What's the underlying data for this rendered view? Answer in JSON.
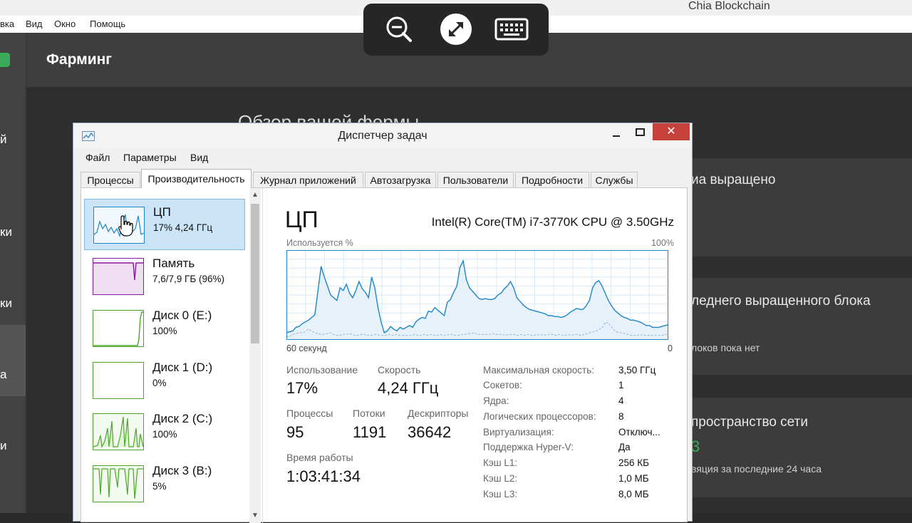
{
  "chia": {
    "window_title": "Chia Blockchain",
    "menu": [
      "вка",
      "Вид",
      "Окно",
      "Помощь"
    ],
    "header_title": "Фарминг",
    "overview_title": "Обзор вашей фермы",
    "sidebar_labels": [
      "й",
      "ки",
      "ки",
      "а",
      "и"
    ],
    "cards": [
      {
        "title": "иа выращено",
        "subtitle": "",
        "value": ""
      },
      {
        "title": "леднего выращенного блока",
        "subtitle": "локов пока нет",
        "value": ""
      },
      {
        "title": "пространство сети",
        "subtitle": "вяция за последние 24 часа",
        "value": "3"
      }
    ],
    "accent_color": "#3aac59"
  },
  "remote_toolbar": {
    "icons": [
      "zoom-out-icon",
      "remote-connection-icon",
      "keyboard-icon"
    ]
  },
  "taskmgr": {
    "title": "Диспетчер задач",
    "close_glyph": "✕",
    "menu": [
      "Файл",
      "Параметры",
      "Вид"
    ],
    "tabs": [
      "Процессы",
      "Производительность",
      "Журнал приложений",
      "Автозагрузка",
      "Пользователи",
      "Подробности",
      "Службы"
    ],
    "active_tab": "Производительность",
    "resources": [
      {
        "name": "ЦП",
        "sub": "17% 4,24 ГГц",
        "color": "#1c86c9"
      },
      {
        "name": "Память",
        "sub": "7,6/7,9 ГБ (96%)",
        "color": "#8b1aa0"
      },
      {
        "name": "Диск 0 (E:)",
        "sub": "100%",
        "color": "#4ca72a"
      },
      {
        "name": "Диск 1 (D:)",
        "sub": "0%",
        "color": "#4ca72a"
      },
      {
        "name": "Диск 2 (C:)",
        "sub": "100%",
        "color": "#4ca72a"
      },
      {
        "name": "Диск 3 (B:)",
        "sub": "5%",
        "color": "#4ca72a"
      }
    ],
    "scroll_up": "▲",
    "scroll_down": "▼",
    "cpu": {
      "title": "ЦП",
      "model": "Intel(R) Core(TM) i7-3770K CPU @ 3.50GHz",
      "graph_label": "Используется %",
      "graph_max": "100%",
      "graph_span": "60 секунд",
      "graph_end": "0",
      "usage_label": "Использование",
      "usage": "17%",
      "speed_label": "Скорость",
      "speed": "4,24 ГГц",
      "processes_label": "Процессы",
      "processes": "95",
      "threads_label": "Потоки",
      "threads": "1191",
      "handles_label": "Дескрипторы",
      "handles": "36642",
      "uptime_label": "Время работы",
      "uptime": "1:03:41:34",
      "props": [
        {
          "k": "Максимальная скорость:",
          "v": "3,50 ГГц"
        },
        {
          "k": "Сокетов:",
          "v": "1"
        },
        {
          "k": "Ядра:",
          "v": "4"
        },
        {
          "k": "Логических процессоров:",
          "v": "8"
        },
        {
          "k": "Виртуализация:",
          "v": "Отключ..."
        },
        {
          "k": "Поддержка Hyper-V:",
          "v": "Да"
        },
        {
          "k": "Кэш L1:",
          "v": "256 КБ"
        },
        {
          "k": "Кэш L2:",
          "v": "1,0 МБ"
        },
        {
          "k": "Кэш L3:",
          "v": "8,0 МБ"
        }
      ],
      "usage_history": [
        8,
        9,
        10,
        14,
        15,
        18,
        20,
        22,
        25,
        28,
        55,
        82,
        70,
        60,
        50,
        47,
        44,
        58,
        55,
        62,
        52,
        47,
        55,
        65,
        57,
        53,
        47,
        70,
        58,
        36,
        20,
        8,
        10,
        15,
        12,
        10,
        14,
        12,
        14,
        16,
        14,
        20,
        23,
        25,
        24,
        32,
        31,
        36,
        33,
        30,
        27,
        42,
        45,
        53,
        60,
        81,
        88,
        67,
        58,
        54,
        50,
        46,
        45,
        46,
        45,
        45,
        46,
        50,
        52,
        57,
        60,
        65,
        58,
        47,
        43,
        39,
        36,
        34,
        33,
        32,
        31,
        30,
        29,
        27,
        27,
        26,
        26,
        25,
        26,
        28,
        31,
        33,
        35,
        34,
        34,
        38,
        44,
        58,
        64,
        66,
        60,
        52,
        44,
        38,
        33,
        30,
        27,
        25,
        24,
        22,
        22,
        21,
        20,
        18,
        16,
        16,
        14,
        14,
        14,
        15,
        16,
        17
      ],
      "kernel_history": [
        3,
        4,
        6,
        7,
        8,
        8,
        9,
        12,
        10,
        8,
        7,
        6,
        6,
        7,
        8,
        6,
        5,
        5,
        6,
        6,
        7,
        6,
        5,
        5,
        6,
        6,
        5,
        5,
        6,
        6,
        5,
        5,
        5,
        6,
        5,
        6,
        5,
        5,
        5,
        5,
        5,
        6,
        5,
        5,
        6,
        5,
        6,
        5,
        5,
        6,
        5,
        5,
        6,
        6,
        5,
        5,
        6,
        6,
        7,
        7,
        8,
        6,
        6,
        6,
        6,
        6,
        7,
        6,
        6,
        6,
        5,
        6,
        6,
        6,
        5,
        6,
        5,
        6,
        5,
        5,
        6,
        5,
        6,
        5,
        6,
        6,
        5,
        6,
        5,
        5,
        6,
        5,
        6,
        6,
        5,
        6,
        7,
        8,
        9,
        10,
        12,
        14,
        20,
        18,
        14,
        10,
        8,
        8,
        7,
        6,
        5,
        5,
        5,
        6,
        5,
        5,
        5,
        5,
        5,
        5,
        5,
        6,
        6
      ]
    }
  }
}
